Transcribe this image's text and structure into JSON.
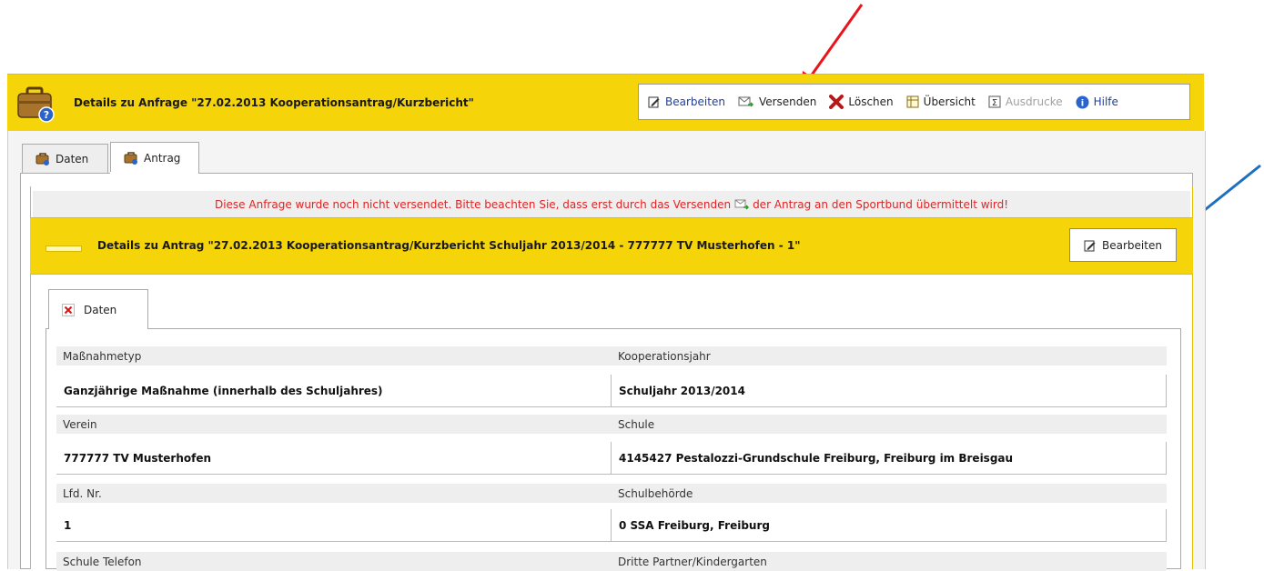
{
  "header": {
    "title": "Details zu  Anfrage \"27.02.2013 Kooperationsantrag/Kurzbericht\""
  },
  "toolbar": {
    "edit": "Bearbeiten",
    "send": "Versenden",
    "delete": "Löschen",
    "overview": "Übersicht",
    "prints": "Ausdrucke",
    "help": "Hilfe"
  },
  "tabs": [
    {
      "label": "Daten",
      "icon": "briefcase-icon"
    },
    {
      "label": "Antrag",
      "icon": "briefcase-icon"
    }
  ],
  "notice": {
    "before": "Diese Anfrage wurde noch nicht versendet. Bitte beachten Sie, dass erst durch das Versenden",
    "after": "der Antrag an den Sportbund übermittelt wird!"
  },
  "section": {
    "title": "Details zu Antrag \"27.02.2013 Kooperationsantrag/Kurzbericht Schuljahr 2013/2014 - 777777 TV Musterhofen - 1\"",
    "edit_button": "Bearbeiten"
  },
  "subtab": {
    "label": "Daten"
  },
  "fields": [
    {
      "label": "Maßnahmetyp",
      "value": "Ganzjährige Maßnahme (innerhalb des Schuljahres)"
    },
    {
      "label": "Kooperationsjahr",
      "value": "Schuljahr 2013/2014"
    },
    {
      "label": "Verein",
      "value": "777777 TV Musterhofen"
    },
    {
      "label": "Schule",
      "value": "4145427 Pestalozzi-Grundschule Freiburg, Freiburg im Breisgau"
    },
    {
      "label": "Lfd. Nr.",
      "value": "1"
    },
    {
      "label": "Schulbehörde",
      "value": "0 SSA Freiburg, Freiburg"
    },
    {
      "label": "Schule Telefon",
      "value": ""
    },
    {
      "label": "Dritte Partner/Kindergarten",
      "value": ""
    }
  ],
  "colors": {
    "header_yellow": "#f6d40a",
    "link_blue": "#1f3f9e",
    "notice_red": "#e02424",
    "arrow_red": "#e8151b",
    "arrow_blue": "#1f6fc0"
  }
}
